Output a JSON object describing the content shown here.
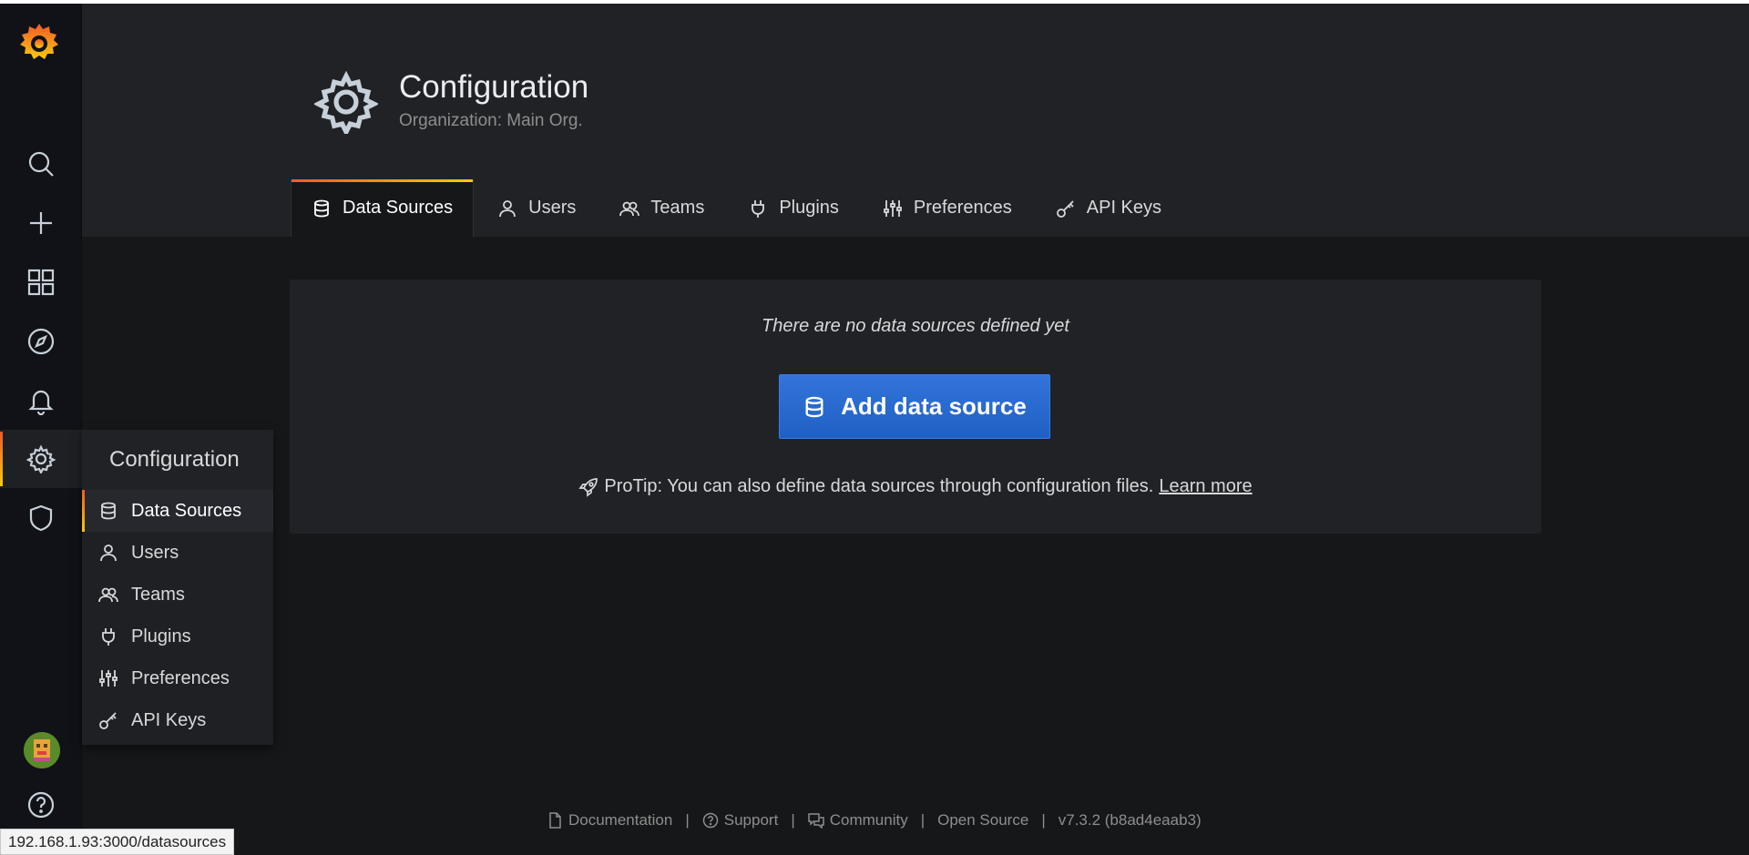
{
  "page": {
    "title": "Configuration",
    "subtitle": "Organization: Main Org."
  },
  "tabs": [
    {
      "label": "Data Sources",
      "icon": "database-icon"
    },
    {
      "label": "Users",
      "icon": "user-icon"
    },
    {
      "label": "Teams",
      "icon": "users-icon"
    },
    {
      "label": "Plugins",
      "icon": "plug-icon"
    },
    {
      "label": "Preferences",
      "icon": "sliders-icon"
    },
    {
      "label": "API Keys",
      "icon": "key-icon"
    }
  ],
  "sidebar": {
    "items": [
      {
        "icon": "search-icon"
      },
      {
        "icon": "plus-icon"
      },
      {
        "icon": "apps-icon"
      },
      {
        "icon": "compass-icon"
      },
      {
        "icon": "bell-icon"
      },
      {
        "icon": "cog-icon"
      },
      {
        "icon": "shield-icon"
      },
      {
        "icon": "help-icon"
      }
    ]
  },
  "flyout": {
    "title": "Configuration",
    "items": [
      {
        "label": "Data Sources",
        "icon": "database-icon"
      },
      {
        "label": "Users",
        "icon": "user-icon"
      },
      {
        "label": "Teams",
        "icon": "users-icon"
      },
      {
        "label": "Plugins",
        "icon": "plug-icon"
      },
      {
        "label": "Preferences",
        "icon": "sliders-icon"
      },
      {
        "label": "API Keys",
        "icon": "key-icon"
      }
    ]
  },
  "empty_state": {
    "message": "There are no data sources defined yet",
    "button_label": "Add data source",
    "protip": "ProTip: You can also define data sources through configuration files.",
    "learn_more": "Learn more"
  },
  "footer": {
    "documentation": "Documentation",
    "support": "Support",
    "community": "Community",
    "open_source": "Open Source",
    "version": "v7.3.2 (b8ad4eaab3)",
    "separator": "|"
  },
  "status_bar": {
    "url": "192.168.1.93:3000/datasources"
  },
  "colors": {
    "accent_start": "#f05a28",
    "accent_end": "#fbca0a",
    "primary_button": "#1f60c4"
  }
}
